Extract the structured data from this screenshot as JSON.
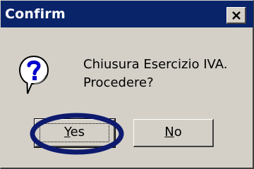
{
  "dialog": {
    "title": "Confirm",
    "message_lines": [
      "Chiusura Esercizio IVA.",
      "Procedere?"
    ],
    "icon": "question-icon",
    "close_icon": "close-icon"
  },
  "buttons": {
    "yes": {
      "accel": "Y",
      "rest": "es"
    },
    "no": {
      "accel": "N",
      "rest": "o"
    }
  },
  "colors": {
    "titlebar": "#0a246a",
    "dialog_bg": "#d4d0c8",
    "annotation": "#0d1a6e"
  }
}
